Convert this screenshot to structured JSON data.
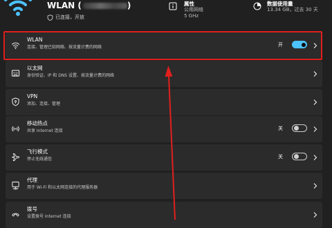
{
  "header": {
    "network_name": "WLAN (",
    "status": "已连接，开放",
    "properties": {
      "title": "属性",
      "line1": "公用网络",
      "line2": "5 GHz"
    },
    "data_usage": {
      "title": "数据使用量",
      "value": "13.34 GB，过去 30 天"
    }
  },
  "rows": [
    {
      "id": "wlan",
      "icon": "wifi-icon",
      "title": "WLAN",
      "desc": "连接、管理已知网络、按流量计费的网络",
      "toggle": "on",
      "toggle_label": "开"
    },
    {
      "id": "ethernet",
      "icon": "ethernet-icon",
      "title": "以太网",
      "desc": "身份验证、IP 和 DNS 设置、按流量计费的网络"
    },
    {
      "id": "vpn",
      "icon": "vpn-shield-icon",
      "title": "VPN",
      "desc": "添加、连接、管理"
    },
    {
      "id": "hotspot",
      "icon": "hotspot-icon",
      "title": "移动热点",
      "desc": "共享 Internet 连接",
      "toggle": "off",
      "toggle_label": "关"
    },
    {
      "id": "airplane",
      "icon": "airplane-icon",
      "title": "飞行模式",
      "desc": "停止无线通信",
      "toggle": "off",
      "toggle_label": "关"
    },
    {
      "id": "proxy",
      "icon": "proxy-icon",
      "title": "代理",
      "desc": "用于 Wi-Fi 和以太网连接的代理服务器"
    },
    {
      "id": "dialup",
      "icon": "dialup-icon",
      "title": "拨号",
      "desc": "设置拨号 Internet 连接"
    }
  ],
  "colors": {
    "background": "#202020",
    "card": "#2b2b2b",
    "accent": "#4cc2ff",
    "annotation": "#e0201d"
  }
}
